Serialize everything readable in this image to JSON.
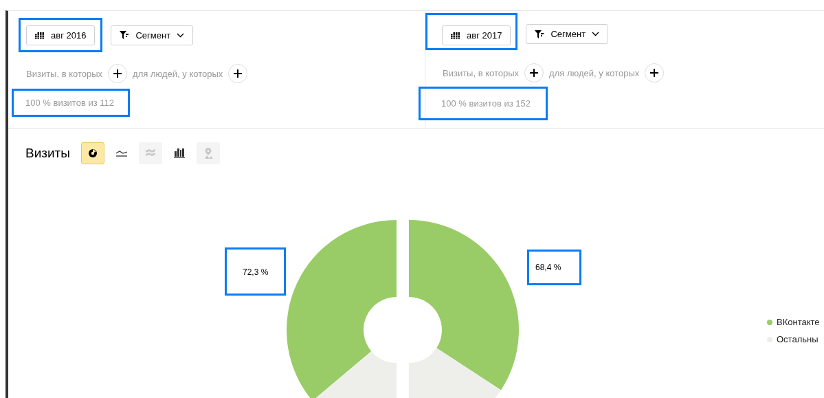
{
  "panels": [
    {
      "date": {
        "label": "авг 2016",
        "highlighted": true
      },
      "segment": {
        "label": "Сегмент"
      },
      "conditions": [
        {
          "label": "Визиты, в которых"
        },
        {
          "label": "для людей, у которых"
        }
      ],
      "summary": {
        "text": "100 % визитов из 112",
        "highlighted": true
      }
    },
    {
      "date": {
        "label": "авг 2017",
        "highlighted": true
      },
      "segment": {
        "label": "Сегмент"
      },
      "conditions": [
        {
          "label": "Визиты, в которых"
        },
        {
          "label": "для людей, у которых"
        }
      ],
      "summary": {
        "text": "100 % визитов из 152",
        "highlighted": true
      }
    }
  ],
  "report": {
    "title": "Визиты",
    "chart_types": [
      {
        "kind": "pie",
        "selected": true,
        "disabled": false
      },
      {
        "kind": "line",
        "selected": false,
        "disabled": false
      },
      {
        "kind": "area",
        "selected": false,
        "disabled": true
      },
      {
        "kind": "bar",
        "selected": false,
        "disabled": false
      },
      {
        "kind": "map",
        "selected": false,
        "disabled": true
      }
    ],
    "data_labels": [
      {
        "text": "72,3 %",
        "highlighted": true
      },
      {
        "text": "68,4 %",
        "highlighted": true
      }
    ],
    "legend": [
      {
        "label": "ВКонтакте",
        "color": "#99cc66"
      },
      {
        "label": "Остальны",
        "color": "#eeeeea"
      }
    ]
  }
}
